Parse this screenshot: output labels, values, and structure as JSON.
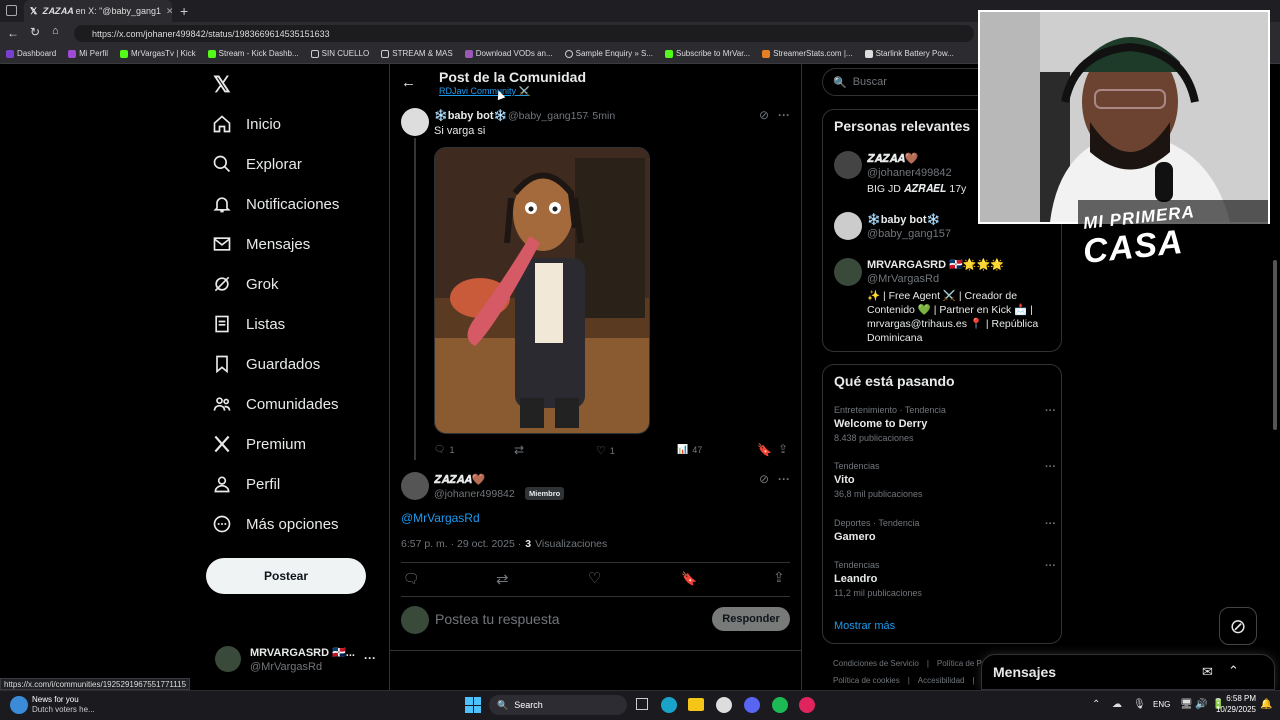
{
  "browser": {
    "tab_title": "𝒁𝑨𝒁𝑨𝑨 en X: \"@baby_gang1",
    "url": "https://x.com/johaner499842/status/1983669614535151633",
    "bookmarks": [
      "Dashboard",
      "Mi Perfil",
      "MrVargasTv | Kick",
      "Stream - Kick Dashb...",
      "SIN CUELLO",
      "STREAM & MAS",
      "Download VODs an...",
      "Sample Enquiry » S...",
      "Subscribe to MrVar...",
      "StreamerStats.com |...",
      "Starlink Battery Pow..."
    ],
    "status_url": "https://x.com/i/communities/1925291967551771115"
  },
  "nav": {
    "items": [
      {
        "label": "Inicio",
        "icon": "home-icon"
      },
      {
        "label": "Explorar",
        "icon": "search-icon"
      },
      {
        "label": "Notificaciones",
        "icon": "bell-icon"
      },
      {
        "label": "Mensajes",
        "icon": "mail-icon"
      },
      {
        "label": "Grok",
        "icon": "grok-icon"
      },
      {
        "label": "Listas",
        "icon": "list-icon"
      },
      {
        "label": "Guardados",
        "icon": "bookmark-icon"
      },
      {
        "label": "Comunidades",
        "icon": "people-icon"
      },
      {
        "label": "Premium",
        "icon": "x-logo-icon"
      },
      {
        "label": "Perfil",
        "icon": "person-icon"
      },
      {
        "label": "Más opciones",
        "icon": "more-circle-icon"
      }
    ],
    "post_button": "Postear",
    "account_name": "MRVARGASRD 🇩🇴...",
    "account_handle": "@MrVargasRd"
  },
  "header": {
    "title": "Post de la Comunidad",
    "community": "RDJavi Community ⚔️"
  },
  "parent_post": {
    "name": "❄️baby bot❄️",
    "handle": "@baby_gang157",
    "time": "· 5min",
    "text": "Si varga si",
    "replies": "1",
    "likes": "1",
    "views": "47"
  },
  "main_post": {
    "name": "𝒁𝑨𝒁𝑨𝑨🤎",
    "handle": "@johaner499842",
    "badge": "Miembro",
    "text": "@MrVargasRd",
    "timestamp": "6:57 p. m. · 29 oct. 2025 ·",
    "views_count": "3",
    "views_label": "Visualizaciones"
  },
  "reply": {
    "placeholder": "Postea tu respuesta",
    "button": "Responder"
  },
  "search": {
    "placeholder": "Buscar"
  },
  "relevant": {
    "title": "Personas relevantes",
    "people": [
      {
        "name": "𝒁𝑨𝒁𝑨𝑨🤎",
        "handle": "@johaner499842",
        "bio": "BIG JD 𝑨𝒁𝑹𝑨𝑬𝑳 17y"
      },
      {
        "name": "❄️baby bot❄️",
        "handle": "@baby_gang157",
        "bio": ""
      },
      {
        "name": "MRVARGASRD 🇩🇴🌟🌟🌟",
        "handle": "@MrVargasRd",
        "bio": "✨ | Free Agent ⚔️ | Creador de Contenido 💚 | Partner en Kick 📩 | mrvargas@trihaus.es 📍 | República Dominicana"
      }
    ]
  },
  "trends": {
    "title": "Qué está pasando",
    "items": [
      {
        "context": "Entretenimiento · Tendencia",
        "name": "Welcome to Derry",
        "count": "8.438 publicaciones"
      },
      {
        "context": "Tendencias",
        "name": "Vito",
        "count": "36,8 mil publicaciones"
      },
      {
        "context": "Deportes · Tendencia",
        "name": "Gamero",
        "count": ""
      },
      {
        "context": "Tendencias",
        "name": "Leandro",
        "count": "11,2 mil publicaciones"
      }
    ],
    "show_more": "Mostrar más"
  },
  "footer_links": [
    "Condiciones de Servicio",
    "Política de Priv",
    "Política de cookies",
    "Accesibilidad"
  ],
  "messages": {
    "title": "Mensajes"
  },
  "overlay": {
    "text_line1": "MI PRIMERA",
    "text_line2": "CASA"
  },
  "taskbar": {
    "news_title": "News for you",
    "news_sub": "Dutch voters he...",
    "search": "Search",
    "lang": "ENG",
    "time": "6:58 PM",
    "date": "10/29/2025"
  },
  "colors": {
    "accent": "#1d9bf0",
    "text": "#e7e9ea",
    "muted": "#71767b",
    "border": "#2f3336"
  }
}
